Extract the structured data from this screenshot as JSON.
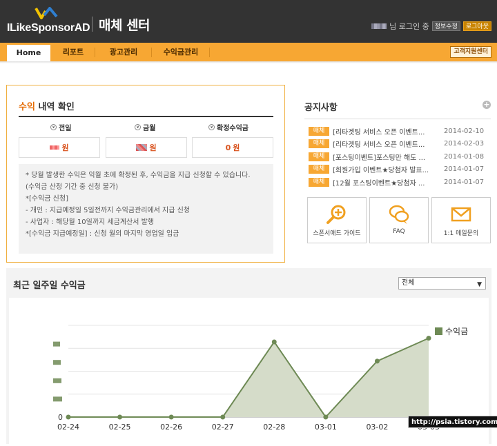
{
  "header": {
    "logo_text": "ILikeSponsorAD",
    "app_title": "매체 센터",
    "login_suffix": "님 로그인 중",
    "info_edit": "정보수정",
    "logout": "로그아웃"
  },
  "nav": {
    "tabs": [
      "Home",
      "리포트",
      "광고관리",
      "수익금관리"
    ],
    "support": "고객지원센터"
  },
  "revenue": {
    "title_highlight": "수익",
    "title_rest": " 내역 확인",
    "columns": [
      {
        "label": "전일",
        "unit": "원"
      },
      {
        "label": "금월",
        "unit": "원"
      },
      {
        "label": "확정수익금",
        "value": "0",
        "unit": "원"
      }
    ],
    "info_lines": [
      "* 당월 발생한 수익은 익월 초에 확정된 후, 수익금을 지급 신청할 수 있습니다.",
      "(수익금 산정 기간 중 신청 불가)",
      "*[수익금 신청]",
      "- 개인 : 지급예정일 5일전까지 수익금관리에서 지급 신청",
      "- 사업자 : 해당월 10일까지 세금계산서 발행",
      "*[수익금 지급예정일] : 신청 월의 마지막 영업일 입금"
    ]
  },
  "notice": {
    "title": "공지사항",
    "items": [
      {
        "badge": "매체",
        "text": "[리타겟팅 서비스 오픈 이벤트...",
        "date": "2014-02-10"
      },
      {
        "badge": "매체",
        "text": "[리타겟팅 서비스 오픈 이벤트...",
        "date": "2014-02-03"
      },
      {
        "badge": "매체",
        "text": "[포스팅이벤트]포스팅만 해도 ...",
        "date": "2014-01-08"
      },
      {
        "badge": "매체",
        "text": "[회원가입 이벤트★당첨자 발표...",
        "date": "2014-01-07"
      },
      {
        "badge": "매체",
        "text": "[12월 포스팅이벤트★당첨자 ...",
        "date": "2014-01-07"
      }
    ]
  },
  "quick_links": [
    {
      "label": "스폰서애드 가이드",
      "icon": "magnifier-plus-icon"
    },
    {
      "label": "FAQ",
      "icon": "speech-bubbles-icon"
    },
    {
      "label": "1:1 메일문의",
      "icon": "envelope-icon"
    }
  ],
  "weekly": {
    "title": "최근 일주일 수익금",
    "select_value": "전체"
  },
  "chart_data": {
    "type": "area",
    "categories": [
      "02-24",
      "02-25",
      "02-26",
      "02-27",
      "02-28",
      "03-01",
      "03-02",
      "03-03"
    ],
    "series": [
      {
        "name": "수익금",
        "values": [
          0,
          0,
          0,
          0,
          0.82,
          0,
          0.61,
          0.86
        ]
      }
    ],
    "y_ticks": [
      "0"
    ],
    "ylim": [
      0,
      1.0
    ],
    "legend_position": "right",
    "grid": true,
    "color": "#6e8a55",
    "fill_color": "#d5dcc9"
  },
  "watermark": "http://psia.tistory.com"
}
